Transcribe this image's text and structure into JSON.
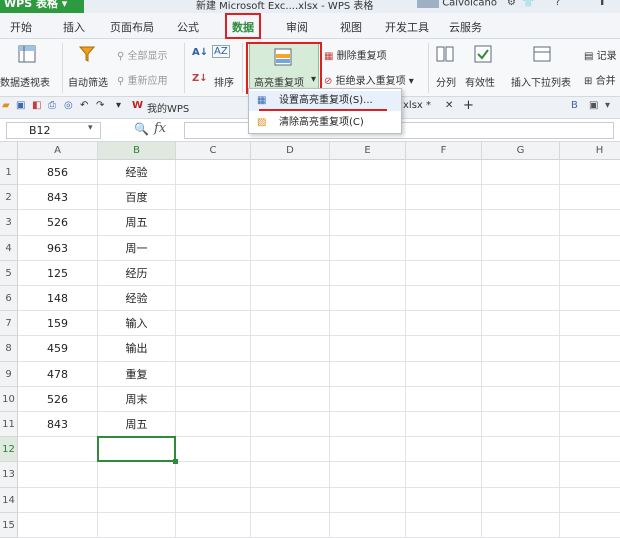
{
  "titlebar": {
    "app_name": "WPS 表格",
    "doc_title": "新建 Microsoft Exc....xlsx - WPS 表格",
    "user": "Caivolcano"
  },
  "menu": {
    "tabs": [
      "开始",
      "插入",
      "页面布局",
      "公式",
      "数据",
      "审阅",
      "视图",
      "开发工具",
      "云服务"
    ],
    "active": "数据"
  },
  "ribbon": {
    "pivot_table": "数据透视表",
    "auto_filter": "自动筛选",
    "show_all": "全部显示",
    "reapply": "重新应用",
    "sort": "排序",
    "highlight_duplicates": "高亮重复项",
    "delete_duplicates": "删除重复项",
    "reject_duplicates": "拒绝录入重复项",
    "split": "分列",
    "validity": "有效性",
    "insert_dropdown": "插入下拉列表",
    "record": "记录",
    "merge": "合并"
  },
  "quickbar": {
    "tab_mywps": "我的WPS",
    "tab_doc": "xlsx *"
  },
  "formula_bar": {
    "cell_ref": "B12",
    "fx": "fx"
  },
  "dropdown": {
    "items": [
      "设置高亮重复项(S)...",
      "清除高亮重复项(C)"
    ]
  },
  "sheet": {
    "columns": [
      "A",
      "B",
      "C",
      "D",
      "E",
      "F",
      "G",
      "H"
    ],
    "rows": [
      "1",
      "2",
      "3",
      "4",
      "5",
      "6",
      "7",
      "8",
      "9",
      "10",
      "11",
      "12",
      "13",
      "14",
      "15"
    ],
    "col_a": [
      "856",
      "843",
      "526",
      "963",
      "125",
      "148",
      "159",
      "459",
      "478",
      "526",
      "843"
    ],
    "col_b": [
      "经验",
      "百度",
      "周五",
      "周一",
      "经历",
      "经验",
      "输入",
      "输出",
      "重复",
      "周末",
      "周五"
    ],
    "active_cell": "B12"
  }
}
